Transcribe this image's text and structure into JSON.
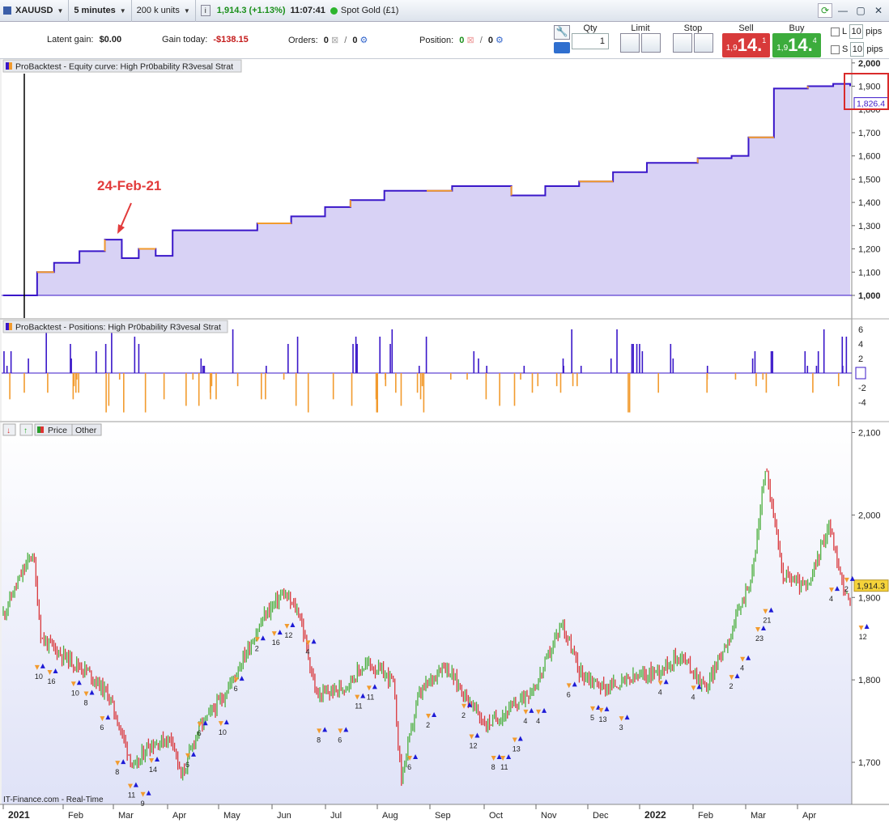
{
  "toolbar": {
    "symbol": "XAUUSD",
    "timeframe": "5 minutes",
    "units": "200 k units",
    "price_change": "1,914.3 (+1.13%)",
    "time": "11:07:41",
    "instrument": "Spot Gold (£1)"
  },
  "info": {
    "latent_gain_label": "Latent gain:",
    "latent_gain_value": "$0.00",
    "gain_today_label": "Gain today:",
    "gain_today_value": "-$138.15",
    "orders_label": "Orders:",
    "orders_a": "0",
    "orders_b": "0",
    "position_label": "Position:",
    "position_a": "0",
    "position_b": "0"
  },
  "order_panel": {
    "qty_label": "Qty",
    "qty_value": "1",
    "limit_label": "Limit",
    "stop_label": "Stop",
    "sell_label": "Sell",
    "buy_label": "Buy",
    "sell_prefix": "1,9",
    "sell_big": "14.",
    "sell_sup": "1",
    "buy_prefix": "1,9",
    "buy_big": "14.",
    "buy_sup": "4",
    "pips_l_label": "L",
    "pips_s_label": "S",
    "pips_value_l": "10",
    "pips_value_s": "10",
    "pips_unit": "pips"
  },
  "panels": {
    "equity_title": "ProBacktest - Equity curve: High Pr0bability R3vesal Strat",
    "positions_title": "ProBacktest - Positions: High Pr0bability R3vesal Strat",
    "price_label": "Price",
    "other_label": "Other",
    "source_text": "IT-Finance.com - Real-Time",
    "annotation": "24-Feb-21"
  },
  "colors": {
    "accent_blue": "#3a17c9",
    "orange": "#f29b2e",
    "equity_fill": "#d8d2f5",
    "candle_up": "#4caf3e",
    "candle_down": "#d9383c"
  },
  "chart_data": [
    {
      "type": "area",
      "title": "ProBacktest - Equity curve: High Pr0bability R3vesal Strat",
      "ylim": [
        900,
        2050
      ],
      "yticks": [
        "2,000",
        "1,900",
        "1,800",
        "1,700",
        "1,600",
        "1,500",
        "1,400",
        "1,300",
        "1,200",
        "1,100",
        "1,000"
      ],
      "last_value_label": "1,826.4",
      "baseline": 1000,
      "x_fraction": [
        0.0,
        0.04,
        0.06,
        0.09,
        0.12,
        0.14,
        0.16,
        0.18,
        0.2,
        0.23,
        0.26,
        0.3,
        0.34,
        0.38,
        0.41,
        0.45,
        0.5,
        0.53,
        0.56,
        0.6,
        0.64,
        0.68,
        0.72,
        0.76,
        0.82,
        0.86,
        0.88,
        0.91,
        0.92,
        0.95,
        0.98,
        1.0
      ],
      "values": [
        1000,
        1100,
        1140,
        1190,
        1240,
        1160,
        1200,
        1170,
        1280,
        1280,
        1280,
        1310,
        1340,
        1380,
        1410,
        1450,
        1450,
        1470,
        1470,
        1430,
        1470,
        1490,
        1530,
        1570,
        1590,
        1600,
        1680,
        1890,
        1890,
        1900,
        1910,
        1900
      ]
    },
    {
      "type": "bar",
      "title": "ProBacktest - Positions: High Pr0bability R3vesal Strat",
      "yticks": [
        "6",
        "4",
        "2",
        "0",
        "-2",
        "-4"
      ],
      "ylim": [
        -6.5,
        6.5
      ]
    },
    {
      "type": "line",
      "title": "XAUUSD",
      "ylim": [
        1640,
        2110
      ],
      "yticks": [
        "2,100",
        "2,000",
        "1,900",
        "1,800",
        "1,700"
      ],
      "last_price_label": "1,914.3",
      "xticks": [
        "2021",
        "Feb",
        "Mar",
        "Apr",
        "May",
        "Jun",
        "Jul",
        "Aug",
        "Sep",
        "Oct",
        "Nov",
        "Dec",
        "2022",
        "Feb",
        "Mar",
        "Apr"
      ],
      "points": [
        {
          "d": 0.0,
          "v": 1880
        },
        {
          "d": 0.025,
          "v": 1935
        },
        {
          "d": 0.035,
          "v": 1955
        },
        {
          "d": 0.045,
          "v": 1850
        },
        {
          "d": 0.07,
          "v": 1830
        },
        {
          "d": 0.1,
          "v": 1810
        },
        {
          "d": 0.125,
          "v": 1780
        },
        {
          "d": 0.14,
          "v": 1735
        },
        {
          "d": 0.155,
          "v": 1690
        },
        {
          "d": 0.17,
          "v": 1720
        },
        {
          "d": 0.2,
          "v": 1730
        },
        {
          "d": 0.21,
          "v": 1680
        },
        {
          "d": 0.23,
          "v": 1740
        },
        {
          "d": 0.26,
          "v": 1780
        },
        {
          "d": 0.29,
          "v": 1840
        },
        {
          "d": 0.31,
          "v": 1880
        },
        {
          "d": 0.33,
          "v": 1905
        },
        {
          "d": 0.35,
          "v": 1880
        },
        {
          "d": 0.37,
          "v": 1780
        },
        {
          "d": 0.4,
          "v": 1790
        },
        {
          "d": 0.43,
          "v": 1820
        },
        {
          "d": 0.46,
          "v": 1800
        },
        {
          "d": 0.47,
          "v": 1680
        },
        {
          "d": 0.49,
          "v": 1780
        },
        {
          "d": 0.52,
          "v": 1820
        },
        {
          "d": 0.54,
          "v": 1790
        },
        {
          "d": 0.57,
          "v": 1745
        },
        {
          "d": 0.6,
          "v": 1765
        },
        {
          "d": 0.63,
          "v": 1795
        },
        {
          "d": 0.66,
          "v": 1870
        },
        {
          "d": 0.68,
          "v": 1810
        },
        {
          "d": 0.71,
          "v": 1790
        },
        {
          "d": 0.74,
          "v": 1800
        },
        {
          "d": 0.77,
          "v": 1810
        },
        {
          "d": 0.8,
          "v": 1830
        },
        {
          "d": 0.83,
          "v": 1790
        },
        {
          "d": 0.86,
          "v": 1860
        },
        {
          "d": 0.885,
          "v": 1930
        },
        {
          "d": 0.9,
          "v": 2060
        },
        {
          "d": 0.92,
          "v": 1930
        },
        {
          "d": 0.95,
          "v": 1910
        },
        {
          "d": 0.975,
          "v": 1990
        },
        {
          "d": 0.99,
          "v": 1920
        },
        {
          "d": 1.0,
          "v": 1890
        }
      ],
      "trade_labels": [
        {
          "d": 0.04,
          "v": 1812,
          "t": "10"
        },
        {
          "d": 0.055,
          "v": 1806,
          "t": "16"
        },
        {
          "d": 0.083,
          "v": 1792,
          "t": "10"
        },
        {
          "d": 0.098,
          "v": 1780,
          "t": "8"
        },
        {
          "d": 0.117,
          "v": 1750,
          "t": "6"
        },
        {
          "d": 0.135,
          "v": 1696,
          "t": "8"
        },
        {
          "d": 0.175,
          "v": 1699,
          "t": "14"
        },
        {
          "d": 0.15,
          "v": 1668,
          "t": "11"
        },
        {
          "d": 0.165,
          "v": 1658,
          "t": "9"
        },
        {
          "d": 0.218,
          "v": 1705,
          "t": "6"
        },
        {
          "d": 0.232,
          "v": 1743,
          "t": "6"
        },
        {
          "d": 0.257,
          "v": 1744,
          "t": "10"
        },
        {
          "d": 0.275,
          "v": 1797,
          "t": "6"
        },
        {
          "d": 0.3,
          "v": 1846,
          "t": "2"
        },
        {
          "d": 0.32,
          "v": 1853,
          "t": "16"
        },
        {
          "d": 0.335,
          "v": 1862,
          "t": "12"
        },
        {
          "d": 0.36,
          "v": 1842,
          "t": "4"
        },
        {
          "d": 0.373,
          "v": 1735,
          "t": "8"
        },
        {
          "d": 0.398,
          "v": 1735,
          "t": "6"
        },
        {
          "d": 0.418,
          "v": 1776,
          "t": "11"
        },
        {
          "d": 0.432,
          "v": 1787,
          "t": "11"
        },
        {
          "d": 0.48,
          "v": 1702,
          "t": "6"
        },
        {
          "d": 0.502,
          "v": 1753,
          "t": "2"
        },
        {
          "d": 0.544,
          "v": 1765,
          "t": "2"
        },
        {
          "d": 0.553,
          "v": 1728,
          "t": "12"
        },
        {
          "d": 0.579,
          "v": 1702,
          "t": "8"
        },
        {
          "d": 0.59,
          "v": 1702,
          "t": "11"
        },
        {
          "d": 0.604,
          "v": 1724,
          "t": "13"
        },
        {
          "d": 0.617,
          "v": 1758,
          "t": "4"
        },
        {
          "d": 0.632,
          "v": 1758,
          "t": "4"
        },
        {
          "d": 0.668,
          "v": 1790,
          "t": "6"
        },
        {
          "d": 0.696,
          "v": 1762,
          "t": "5"
        },
        {
          "d": 0.706,
          "v": 1760,
          "t": "13"
        },
        {
          "d": 0.73,
          "v": 1750,
          "t": "3"
        },
        {
          "d": 0.776,
          "v": 1793,
          "t": "4"
        },
        {
          "d": 0.815,
          "v": 1787,
          "t": "4"
        },
        {
          "d": 0.86,
          "v": 1800,
          "t": "2"
        },
        {
          "d": 0.873,
          "v": 1822,
          "t": "4"
        },
        {
          "d": 0.891,
          "v": 1858,
          "t": "23"
        },
        {
          "d": 0.9,
          "v": 1880,
          "t": "21"
        },
        {
          "d": 0.978,
          "v": 1906,
          "t": "4"
        },
        {
          "d": 0.996,
          "v": 1918,
          "t": "2"
        },
        {
          "d": 1.013,
          "v": 1860,
          "t": "12"
        }
      ]
    }
  ]
}
